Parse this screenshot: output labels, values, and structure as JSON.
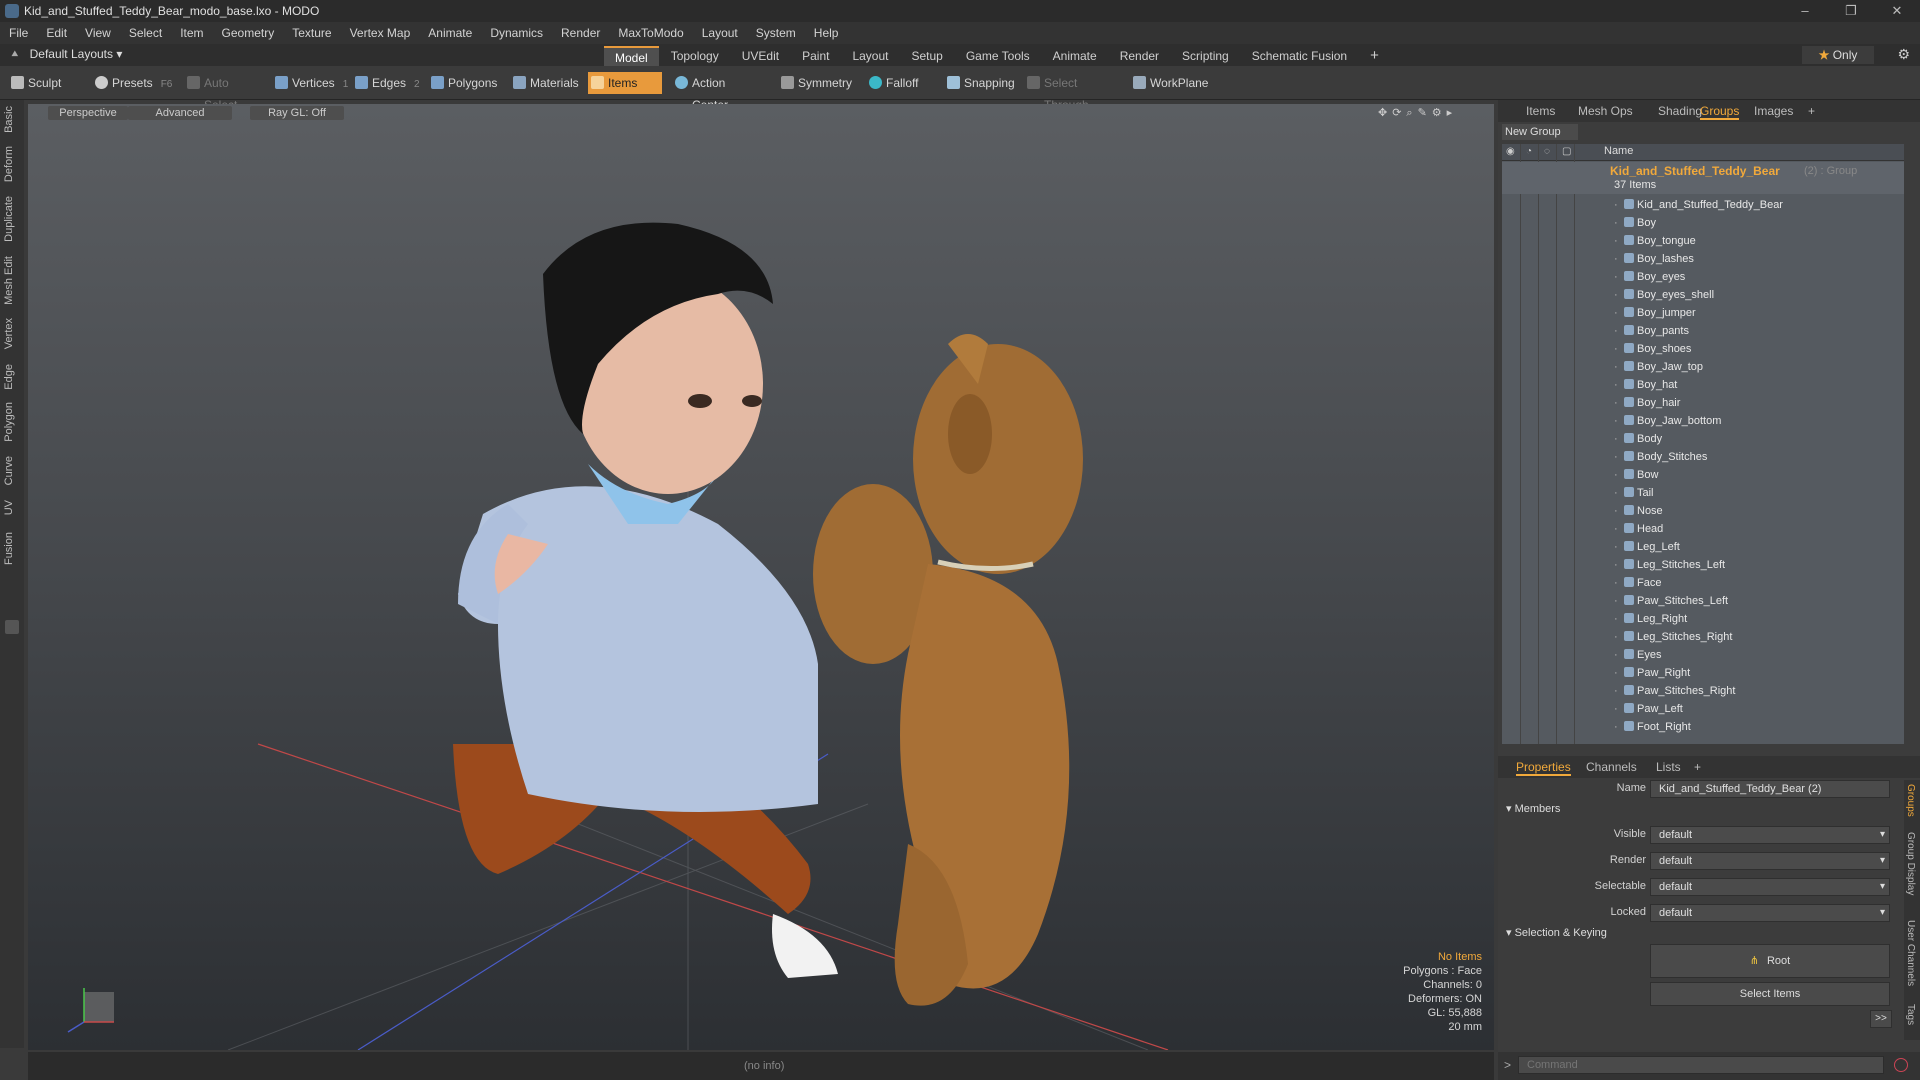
{
  "window": {
    "title": "Kid_and_Stuffed_Teddy_Bear_modo_base.lxo - MODO"
  },
  "menu": [
    "File",
    "Edit",
    "View",
    "Select",
    "Item",
    "Geometry",
    "Texture",
    "Vertex Map",
    "Animate",
    "Dynamics",
    "Render",
    "MaxToModo",
    "Layout",
    "System",
    "Help"
  ],
  "layout": {
    "selector": "Default Layouts ▾",
    "tabs": [
      "Model",
      "Topology",
      "UVEdit",
      "Paint",
      "Layout",
      "Setup",
      "Game Tools",
      "Animate",
      "Render",
      "Scripting",
      "Schematic Fusion"
    ],
    "active_tab": "Model",
    "only_label": "Only"
  },
  "toolbar": {
    "sculpt": "Sculpt",
    "presets": "Presets",
    "presets_key": "F6",
    "auto_select": "Auto Select",
    "vertices": "Vertices",
    "vertices_count": "1",
    "edges": "Edges",
    "edges_count": "2",
    "polygons": "Polygons",
    "materials": "Materials",
    "items": "Items",
    "action_center": "Action Center",
    "symmetry": "Symmetry",
    "falloff": "Falloff",
    "snapping": "Snapping",
    "select_through": "Select Through",
    "workplane": "WorkPlane"
  },
  "left_tabs": [
    "Basic",
    "Deform",
    "Duplicate",
    "Mesh Edit",
    "Vertex",
    "Edge",
    "Polygon",
    "Curve",
    "UV",
    "Fusion"
  ],
  "viewport": {
    "perspective": "Perspective",
    "advanced": "Advanced",
    "raygl": "Ray GL: Off",
    "info": {
      "no_items": "No Items",
      "polygons": "Polygons : Face",
      "channels": "Channels: 0",
      "deformers": "Deformers: ON",
      "gl": "GL: 55,888",
      "scale": "20 mm"
    }
  },
  "statusbar": {
    "info": "(no info)"
  },
  "panel_tabs": [
    "Items",
    "Mesh Ops",
    "Shading",
    "Groups",
    "Images"
  ],
  "panel_active": "Groups",
  "new_group": "New Group",
  "tree": {
    "name_col": "Name",
    "group_name": "Kid_and_Stuffed_Teddy_Bear",
    "group_suffix": "(2) : Group",
    "count": "37 Items",
    "items": [
      "Kid_and_Stuffed_Teddy_Bear",
      "Boy",
      "Boy_tongue",
      "Boy_lashes",
      "Boy_eyes",
      "Boy_eyes_shell",
      "Boy_jumper",
      "Boy_pants",
      "Boy_shoes",
      "Boy_Jaw_top",
      "Boy_hat",
      "Boy_hair",
      "Boy_Jaw_bottom",
      "Body",
      "Body_Stitches",
      "Bow",
      "Tail",
      "Nose",
      "Head",
      "Leg_Left",
      "Leg_Stitches_Left",
      "Face",
      "Paw_Stitches_Left",
      "Leg_Right",
      "Leg_Stitches_Right",
      "Eyes",
      "Paw_Right",
      "Paw_Stitches_Right",
      "Paw_Left",
      "Foot_Right"
    ]
  },
  "props_tabs": [
    "Properties",
    "Channels",
    "Lists"
  ],
  "props": {
    "name_label": "Name",
    "name_value": "Kid_and_Stuffed_Teddy_Bear (2)",
    "members": "Members",
    "visible_label": "Visible",
    "visible": "default",
    "render_label": "Render",
    "render": "default",
    "selectable_label": "Selectable",
    "selectable": "default",
    "locked_label": "Locked",
    "locked": "default",
    "selection_keying": "Selection & Keying",
    "root": "Root",
    "select_items": "Select Items",
    "more": ">>"
  },
  "side_tabs": [
    "Groups",
    "Group Display",
    "User Channels",
    "Tags"
  ],
  "command": {
    "placeholder": "Command"
  },
  "colors": {
    "accent": "#e89a3c",
    "highlight_text": "#f1a93b"
  }
}
